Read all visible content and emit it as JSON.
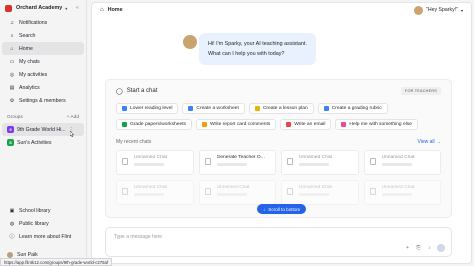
{
  "workspace": {
    "name": "Orchard Academy",
    "logo_color": "#d9312b"
  },
  "nav": [
    {
      "label": "Notifications",
      "icon": "bell-icon",
      "glyph": "♫"
    },
    {
      "label": "Search",
      "icon": "search-icon",
      "glyph": "⌕"
    },
    {
      "label": "Home",
      "icon": "home-icon",
      "glyph": "⌂",
      "active": true
    },
    {
      "label": "My chats",
      "icon": "chat-icon",
      "glyph": "▭"
    },
    {
      "label": "My activities",
      "icon": "activity-icon",
      "glyph": "◎"
    },
    {
      "label": "Analytics",
      "icon": "analytics-icon",
      "glyph": "▤"
    },
    {
      "label": "Settings & members",
      "icon": "gear-icon",
      "glyph": "⚙"
    }
  ],
  "groups": {
    "header": "Groups",
    "add_label": "Add",
    "items": [
      {
        "label": "9th Grade World Hi...",
        "badge": "9",
        "color": "#7c3aed"
      },
      {
        "label": "Sun's Activities",
        "badge": "S",
        "color": "#16a34a"
      }
    ]
  },
  "bottom_nav": [
    {
      "label": "School library",
      "icon": "library-icon"
    },
    {
      "label": "Public library",
      "icon": "globe-icon"
    },
    {
      "label": "Learn more about Flint",
      "icon": "info-icon"
    }
  ],
  "user": {
    "name": "Sun Paik"
  },
  "header": {
    "title": "Home",
    "assistant_label": "\"Hey Sparky!\""
  },
  "greeting": {
    "line1": "Hi! I'm Sparky, your AI teaching assistant.",
    "line2": "What can I help you with today?"
  },
  "start_chat": {
    "title": "Start a chat",
    "badge": "FOR TEACHERS",
    "chips": [
      {
        "label": "Lower reading level",
        "color": "#3b82f6"
      },
      {
        "label": "Create a worksheet",
        "color": "#3b82f6"
      },
      {
        "label": "Create a lesson plan",
        "color": "#eab308"
      },
      {
        "label": "Create a grading rubric",
        "color": "#3b82f6"
      },
      {
        "label": "Grade papers/worksheets",
        "color": "#16a34a"
      },
      {
        "label": "Write report card comments",
        "color": "#f59e0b"
      },
      {
        "label": "Write an email",
        "color": "#ef4444"
      },
      {
        "label": "Help me with something else",
        "color": "#ec4899"
      }
    ]
  },
  "recent": {
    "title": "My recent chats",
    "view_all": "View all",
    "row1": [
      "Unnamed Chat",
      "Generate Teacher O...",
      "Unnamed Chat",
      "Unnamed Chat"
    ],
    "row2": [
      "Unnamed Chat",
      "Unnamed Chat",
      "Unnamed Chat",
      "Unnamed Chat"
    ]
  },
  "scroll_button": "Scroll to bottom",
  "composer": {
    "placeholder": "Type a message here"
  },
  "status_url": "https://app.flintk12.com/groups/9th-grade-world-c275af"
}
